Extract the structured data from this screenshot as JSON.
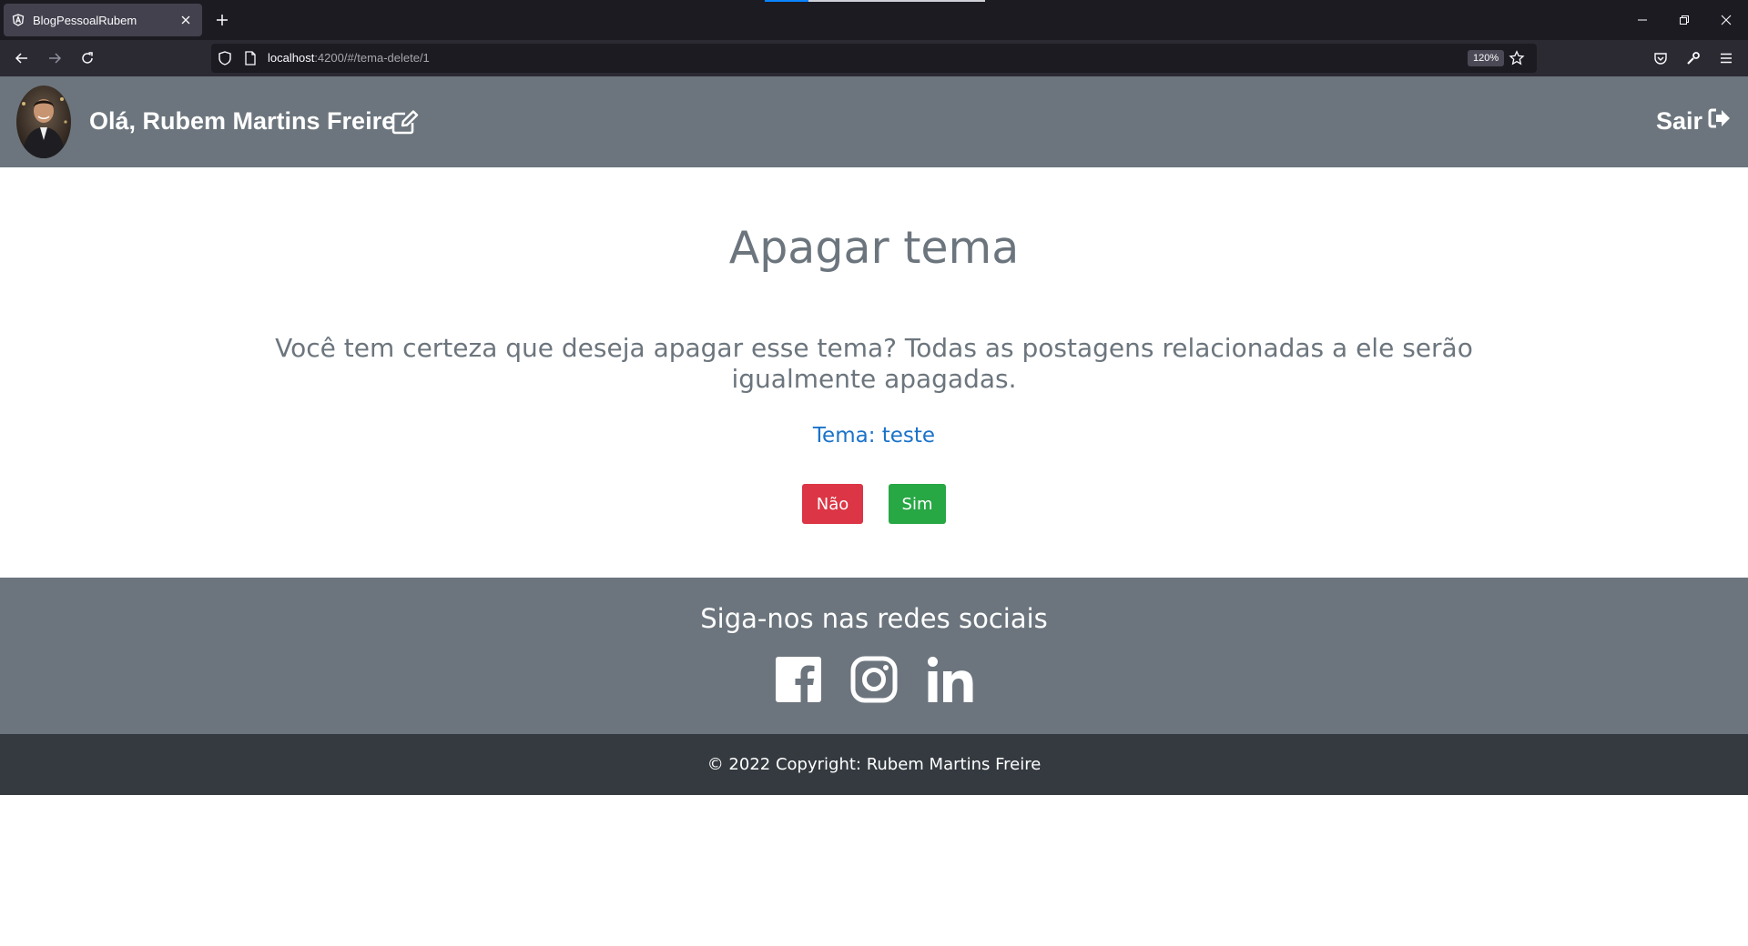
{
  "browser": {
    "tab_title": "BlogPessoalRubem",
    "url_host": "localhost",
    "url_rest": ":4200/#/tema-delete/1",
    "zoom": "120%"
  },
  "header": {
    "greeting": "Olá, Rubem Martins Freire",
    "logout_label": "Sair"
  },
  "main": {
    "title": "Apagar tema",
    "question": "Você tem certeza que deseja apagar esse tema? Todas as postagens relacionadas a ele serão igualmente apagadas.",
    "tema_label": "Tema: teste",
    "no_label": "Não",
    "yes_label": "Sim"
  },
  "footer": {
    "social_title": "Siga-nos nas redes sociais",
    "copyright": "© 2022 Copyright: Rubem Martins Freire"
  },
  "colors": {
    "header_bg": "#6c757d",
    "footer_dark": "#343a40",
    "danger": "#dc3545",
    "success": "#28a745",
    "link": "#1a73c9"
  }
}
